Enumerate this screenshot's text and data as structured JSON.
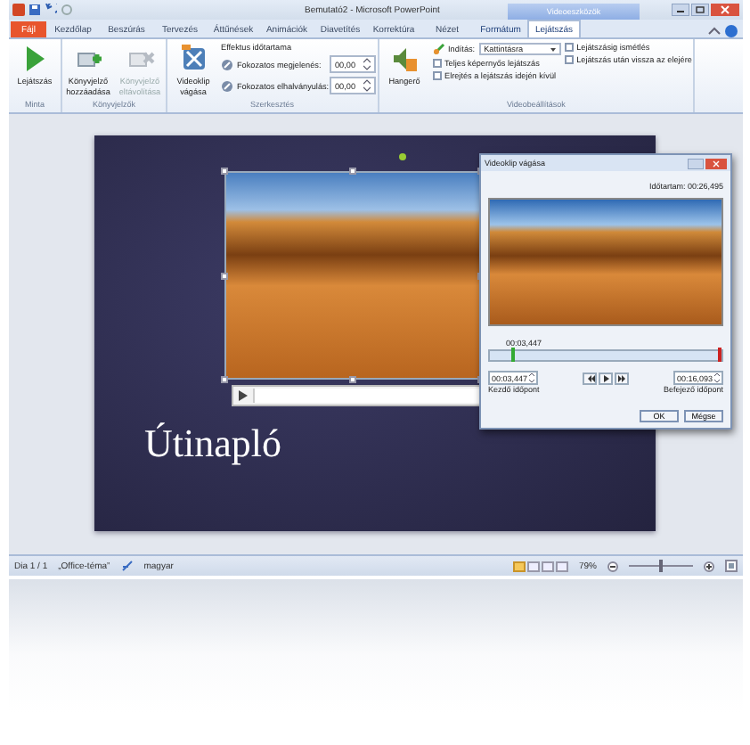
{
  "window": {
    "title": "Bemutató2 - Microsoft PowerPoint"
  },
  "contextual_group": "Videoeszközök",
  "ribbon_tabs": [
    {
      "label": "Fájl",
      "kind": "file",
      "selected": false
    },
    {
      "label": "Kezdőlap",
      "kind": "tab",
      "selected": false
    },
    {
      "label": "Beszúrás",
      "kind": "tab",
      "selected": false
    },
    {
      "label": "Tervezés",
      "kind": "tab",
      "selected": false
    },
    {
      "label": "Áttűnések",
      "kind": "tab",
      "selected": false
    },
    {
      "label": "Animációk",
      "kind": "tab",
      "selected": false
    },
    {
      "label": "Diavetítés",
      "kind": "tab",
      "selected": false
    },
    {
      "label": "Korrektúra",
      "kind": "tab",
      "selected": false
    },
    {
      "label": "Nézet",
      "kind": "tab",
      "selected": false
    },
    {
      "label": "Formátum",
      "kind": "context",
      "selected": false
    },
    {
      "label": "Lejátszás",
      "kind": "context",
      "selected": true
    }
  ],
  "ribbon_groups": [
    {
      "label": "Minta",
      "columns": [
        [
          {
            "kind": "large",
            "label": "Lejátszás",
            "disabled": false
          }
        ]
      ]
    },
    {
      "label": "Könyvjelzők",
      "columns": [
        [
          {
            "kind": "large",
            "label": "Könyvjelző hozzáadása",
            "disabled": false
          }
        ],
        [
          {
            "kind": "large",
            "label": "Könyvjelző eltávolítása",
            "disabled": true
          }
        ]
      ]
    },
    {
      "label": "Szerkesztés",
      "columns": [
        [
          {
            "kind": "large",
            "label": "Videoklip vágása",
            "disabled": false
          }
        ],
        [
          {
            "kind": "heading",
            "label": "Effektus időtartama"
          },
          {
            "kind": "spin",
            "label": "Fokozatos megjelenés:",
            "value": "00,00"
          },
          {
            "kind": "spin",
            "label": "Fokozatos elhalványulás:",
            "value": "00,00"
          }
        ]
      ]
    },
    {
      "label": "Videobeállítások",
      "columns": [
        [
          {
            "kind": "large",
            "label": "Hangerő",
            "disabled": false
          }
        ],
        [
          {
            "kind": "dropdown",
            "label": "Indítás:",
            "value": "Kattintásra"
          },
          {
            "kind": "check",
            "label": "Teljes képernyős lejátszás",
            "checked": false
          },
          {
            "kind": "check",
            "label": "Elrejtés a lejátszás idején kívül",
            "checked": false
          }
        ],
        [
          {
            "kind": "check",
            "label": "Lejátszásig ismétlés",
            "checked": false
          },
          {
            "kind": "check",
            "label": "Lejátszás után vissza az elejére",
            "checked": false
          }
        ]
      ]
    }
  ],
  "slide": {
    "title": "Útinapló"
  },
  "trim_dialog": {
    "title": "Videoklip vágása",
    "duration": "Időtartam:  00:26,495",
    "position": "00:03,447",
    "start": {
      "value": "00:03,447",
      "label": "Kezdő időpont",
      "level": 0.1
    },
    "end": {
      "value": "00:16,093",
      "label": "Befejező időpont",
      "level": 1
    },
    "buttons": [
      "OK",
      "Mégse"
    ]
  },
  "status_bar": {
    "items": [
      "Dia 1 / 1",
      "„Office-téma”",
      "magyar"
    ],
    "views": [
      {
        "selected": true
      },
      {
        "selected": false
      },
      {
        "selected": false
      },
      {
        "selected": false
      }
    ],
    "zoom": {
      "reading": "79%",
      "level": 0.5
    }
  }
}
